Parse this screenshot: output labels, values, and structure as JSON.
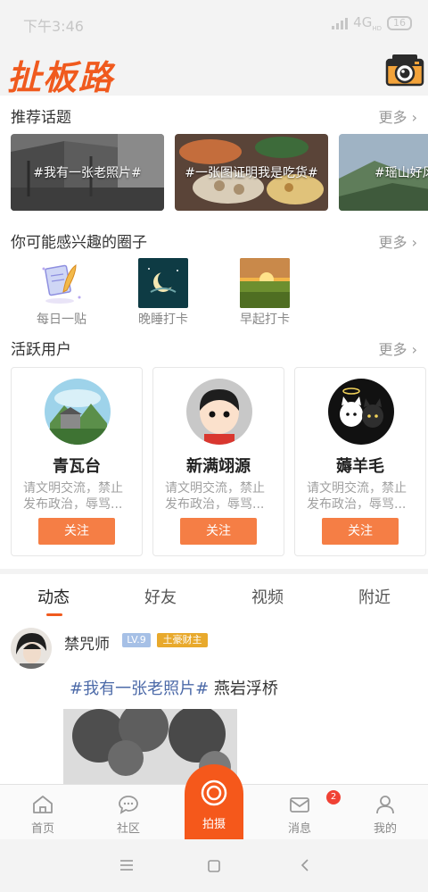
{
  "status_bar": {
    "time": "下午3:46",
    "network": "4G",
    "network_suffix": "HD",
    "battery": "16"
  },
  "header": {
    "app_name": "扯板路",
    "camera_icon": "retro-camera-icon"
  },
  "recommended_topics": {
    "title": "推荐话题",
    "more": "更多",
    "items": [
      {
        "tag": "#我有一张老照片#"
      },
      {
        "tag": "#一张图证明我是吃货#"
      },
      {
        "tag": "#瑶山好风"
      }
    ]
  },
  "circles": {
    "title": "你可能感兴趣的圈子",
    "more": "更多",
    "items": [
      {
        "label": "每日一贴"
      },
      {
        "label": "晚睡打卡"
      },
      {
        "label": "早起打卡"
      }
    ]
  },
  "active_users": {
    "title": "活跃用户",
    "more": "更多",
    "items": [
      {
        "name": "青瓦台",
        "bio": "请文明交流，禁止发布政治，辱骂...",
        "follow": "关注"
      },
      {
        "name": "新满翊源",
        "bio": "请文明交流，禁止发布政治，辱骂...",
        "follow": "关注"
      },
      {
        "name": "薅羊毛",
        "bio": "请文明交流，禁止发布政治，辱骂...",
        "follow": "关注"
      }
    ]
  },
  "feed": {
    "tabs": [
      {
        "label": "动态"
      },
      {
        "label": "好友"
      },
      {
        "label": "视频"
      },
      {
        "label": "附近"
      }
    ],
    "active_tab": "动态",
    "post": {
      "user": "禁咒师",
      "level": "LV.9",
      "rank": "土豪财主",
      "hashtag": "#我有一张老照片#",
      "text": " 燕岩浮桥"
    }
  },
  "bottom_nav": {
    "items": [
      {
        "label": "首页",
        "icon": "home-icon"
      },
      {
        "label": "社区",
        "icon": "chat-bubble-icon"
      },
      {
        "label": "拍摄",
        "icon": "shutter-icon"
      },
      {
        "label": "消息",
        "icon": "mail-icon",
        "badge": "2"
      },
      {
        "label": "我的",
        "icon": "person-icon"
      }
    ]
  },
  "colors": {
    "brand": "#f05a1e",
    "follow_button": "#f57e45",
    "hashtag": "#4c6aa8"
  }
}
